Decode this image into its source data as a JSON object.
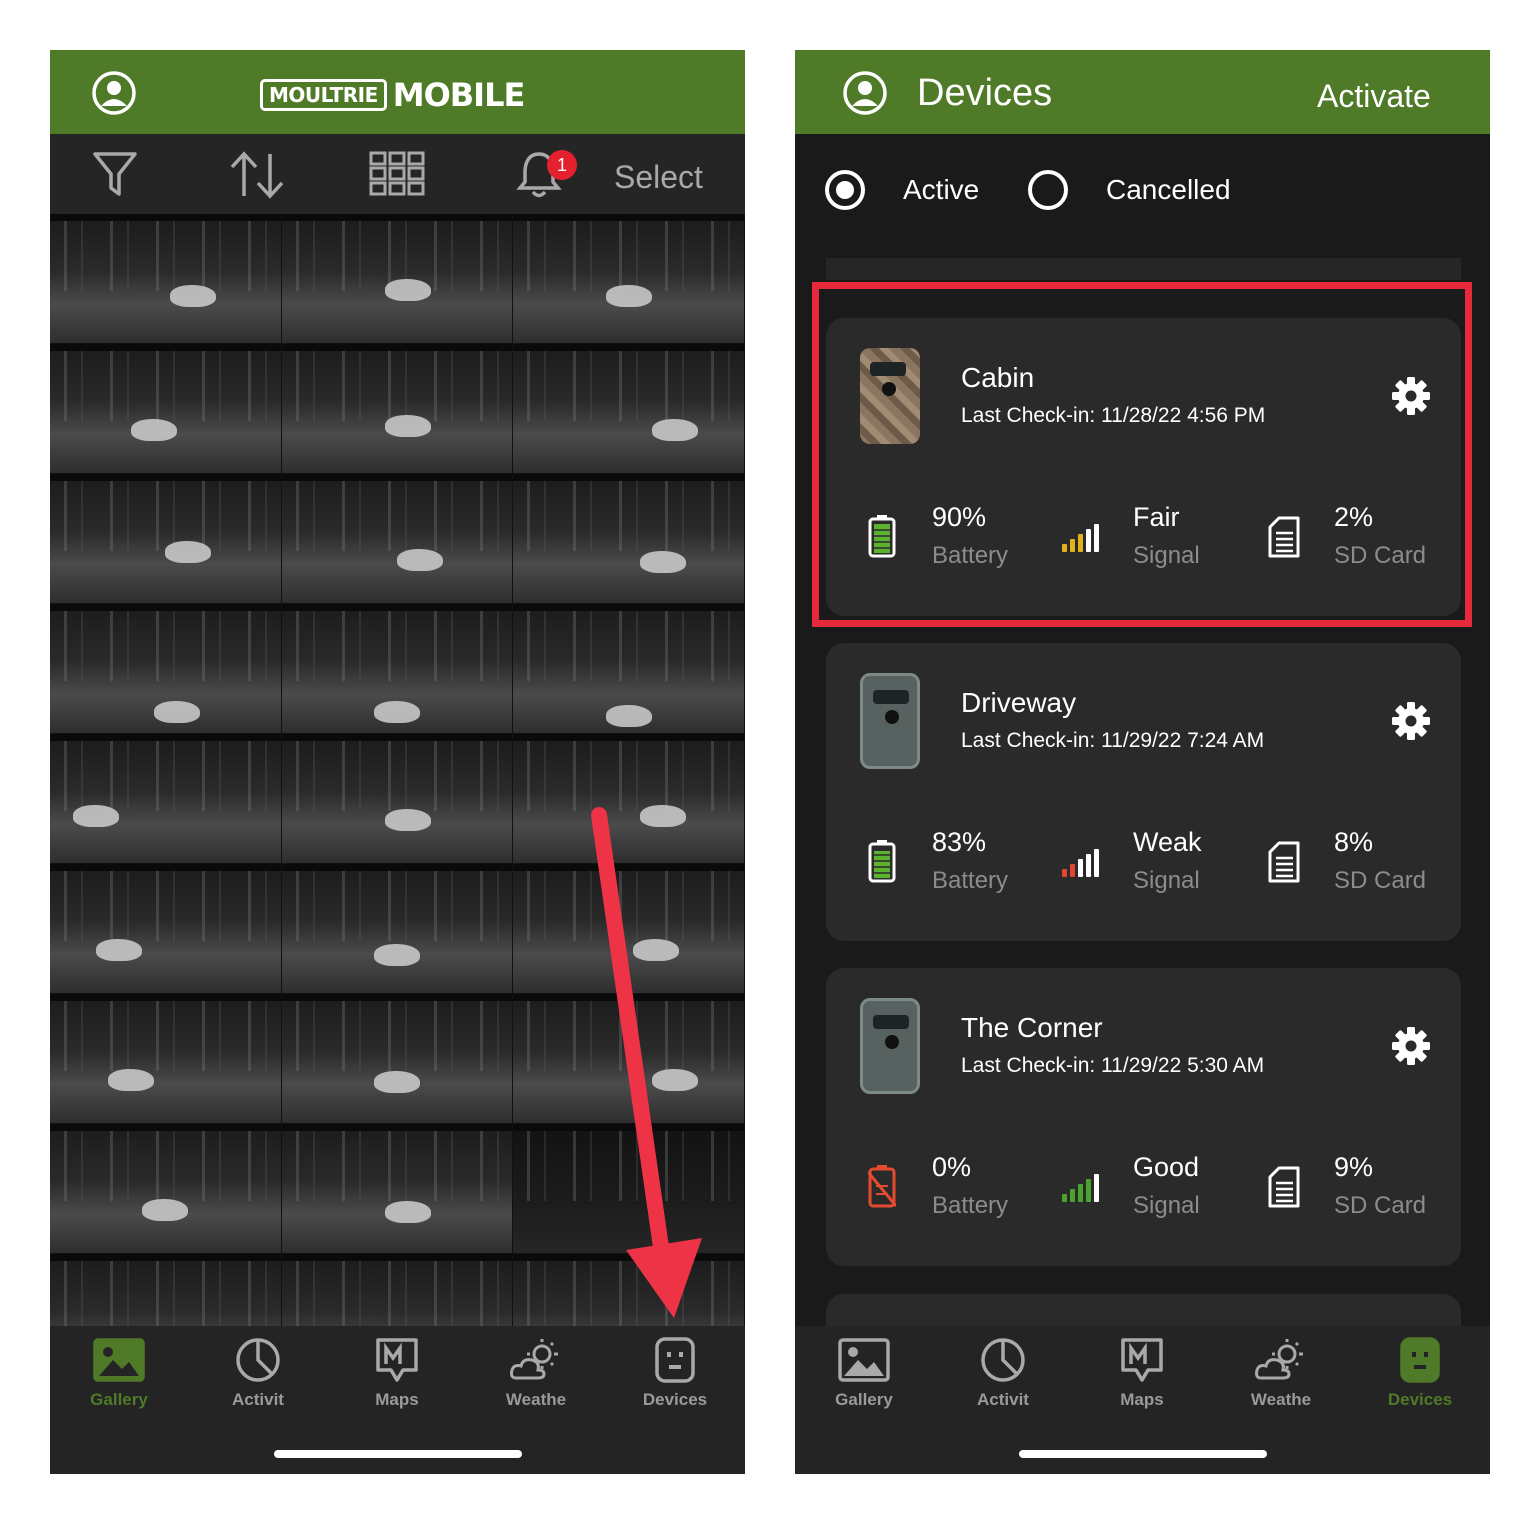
{
  "left_screen": {
    "logo": {
      "brand": "MOULTRIE",
      "product": "MOBILE"
    },
    "toolbar": {
      "select_label": "Select",
      "notification_count": "1"
    },
    "gallery_rows": 9,
    "nav": [
      {
        "label": "Gallery",
        "icon": "gallery-icon",
        "active": true
      },
      {
        "label": "Activit",
        "icon": "activity-icon",
        "active": false
      },
      {
        "label": "Maps",
        "icon": "maps-icon",
        "active": false
      },
      {
        "label": "Weathe",
        "icon": "weather-icon",
        "active": false
      },
      {
        "label": "Devices",
        "icon": "devices-icon",
        "active": false
      }
    ]
  },
  "right_screen": {
    "header": {
      "title": "Devices",
      "action": "Activate"
    },
    "filter": {
      "options": [
        "Active",
        "Cancelled"
      ],
      "selected": "Active"
    },
    "devices": [
      {
        "name": "Cabin",
        "checkin": "Last Check-in: 11/28/22 4:56 PM",
        "battery": "90%",
        "battery_label": "Battery",
        "signal": "Fair",
        "signal_label": "Signal",
        "sd": "2%",
        "sd_label": "SD Card",
        "camera_style": "camo",
        "battery_level": 0.9,
        "signal_bars": 3,
        "signal_color": "#e3b21b",
        "highlighted": true
      },
      {
        "name": "Driveway",
        "checkin": "Last Check-in: 11/29/22 7:24 AM",
        "battery": "83%",
        "battery_label": "Battery",
        "signal": "Weak",
        "signal_label": "Signal",
        "sd": "8%",
        "sd_label": "SD Card",
        "camera_style": "grey",
        "battery_level": 0.83,
        "signal_bars": 2,
        "signal_color": "#e04530",
        "highlighted": false
      },
      {
        "name": "The Corner",
        "checkin": "Last Check-in: 11/29/22 5:30 AM",
        "battery": "0%",
        "battery_label": "Battery",
        "signal": "Good",
        "signal_label": "Signal",
        "sd": "9%",
        "sd_label": "SD Card",
        "camera_style": "grey",
        "battery_level": 0,
        "signal_bars": 4,
        "signal_color": "#4aa32b",
        "highlighted": false
      }
    ],
    "nav": [
      {
        "label": "Gallery",
        "icon": "gallery-icon",
        "active": false
      },
      {
        "label": "Activit",
        "icon": "activity-icon",
        "active": false
      },
      {
        "label": "Maps",
        "icon": "maps-icon",
        "active": false
      },
      {
        "label": "Weathe",
        "icon": "weather-icon",
        "active": false
      },
      {
        "label": "Devices",
        "icon": "devices-icon",
        "active": true
      }
    ]
  },
  "colors": {
    "brand_green": "#4f7a28",
    "highlight_red": "#e6293b",
    "annotation_arrow": "#ee3346",
    "battery_green": "#5cb130",
    "battery_empty_red": "#e54b2e"
  }
}
